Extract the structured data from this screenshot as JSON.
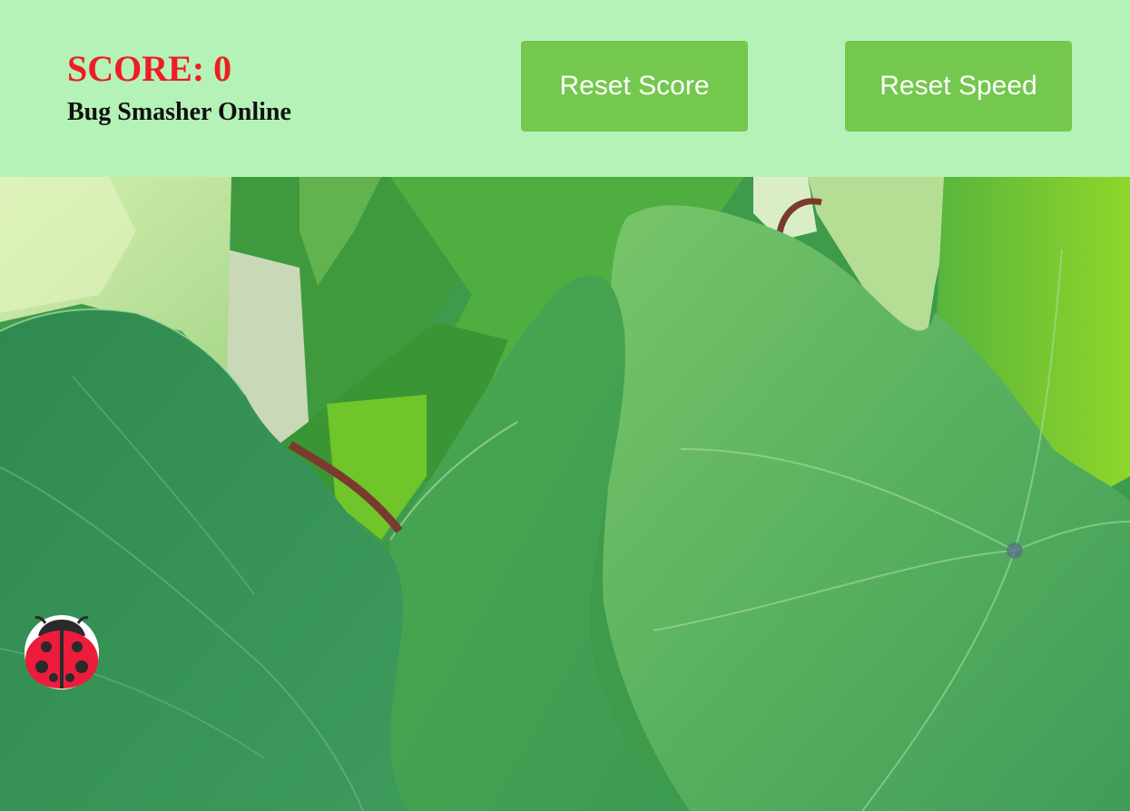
{
  "header": {
    "score_label": "SCORE: 0",
    "subtitle": "Bug Smasher Online",
    "reset_score_label": "Reset Score",
    "reset_speed_label": "Reset Speed"
  },
  "game": {
    "score": 0,
    "bug": "ladybug"
  },
  "colors": {
    "header_bg": "#b5f2b7",
    "score_text": "#ee1c24",
    "button_bg": "#74c84d",
    "button_text": "#ffffff",
    "ladybug_red": "#ee1c3c"
  }
}
